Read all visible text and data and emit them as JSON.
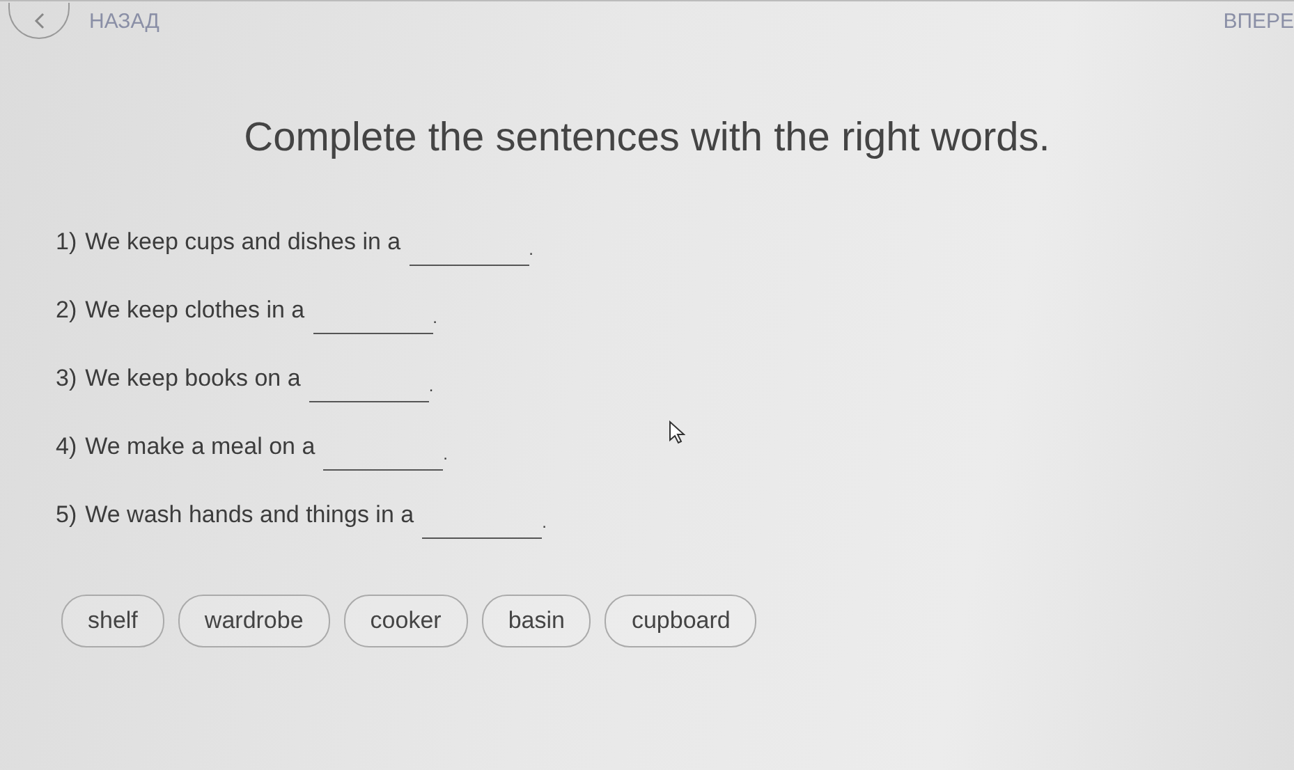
{
  "nav": {
    "back_label": "НАЗАД",
    "forward_label": "ВПЕРЕ"
  },
  "title": "Complete the sentences with the right words.",
  "sentences": [
    {
      "number": "1)",
      "text": "We keep cups and dishes in a",
      "end": "."
    },
    {
      "number": "2)",
      "text": "We keep clothes in a",
      "end": "."
    },
    {
      "number": "3)",
      "text": "We keep books on a",
      "end": "."
    },
    {
      "number": "4)",
      "text": "We make a meal on a",
      "end": "."
    },
    {
      "number": "5)",
      "text": "We wash hands and things in a",
      "end": "."
    }
  ],
  "words": [
    "shelf",
    "wardrobe",
    "cooker",
    "basin",
    "cupboard"
  ]
}
